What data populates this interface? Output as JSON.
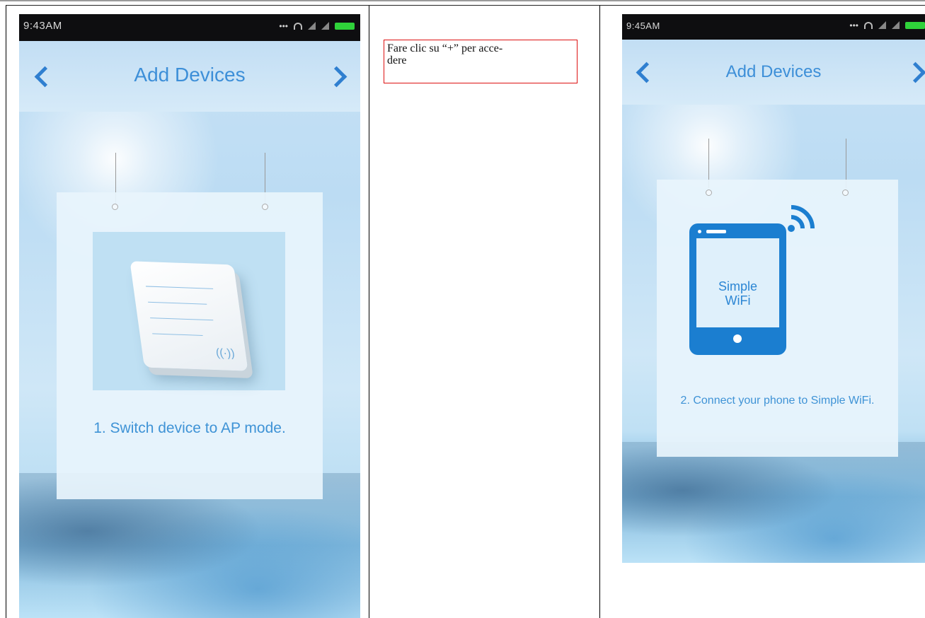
{
  "left_screen": {
    "status_time": "9:43AM",
    "title": "Add Devices",
    "step_text": "1. Switch device to AP mode."
  },
  "middle_cell": {
    "caption_line1": "Fare clic su “+” per acce-",
    "caption_line2": "dere"
  },
  "right_screen": {
    "status_time": "9:45AM",
    "title": "Add Devices",
    "phone_label_line1": "Simple",
    "phone_label_line2": "WiFi",
    "step_text": "2. Connect your phone to Simple WiFi."
  },
  "colors": {
    "accent_blue": "#3d8fd8",
    "phone_blue": "#1b7ed0",
    "battery_green": "#2fd23a",
    "caption_border_red": "#dd1111"
  },
  "icons": [
    "back-chevron-icon",
    "forward-chevron-icon",
    "wifi-icon",
    "signal-icon",
    "battery-icon",
    "router-device-icon",
    "smartphone-icon",
    "wifi-signal-icon"
  ]
}
